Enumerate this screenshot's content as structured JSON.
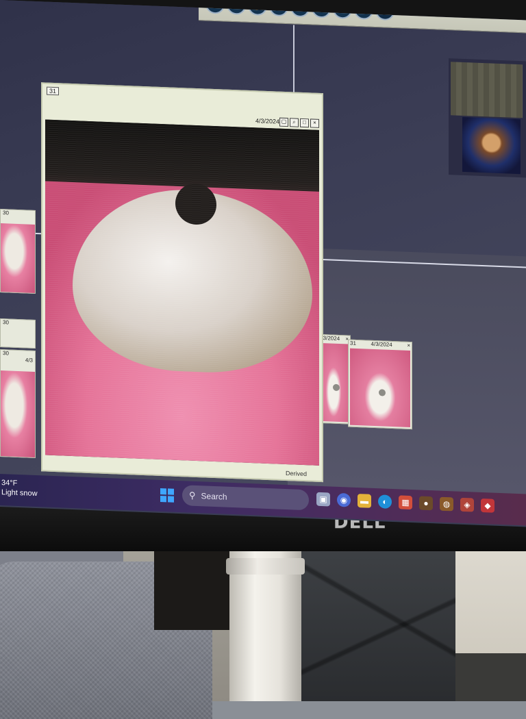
{
  "monitor": {
    "brand": "DELL"
  },
  "toolbar": {
    "close_label": "X"
  },
  "main_window": {
    "tooth_number": "31",
    "date": "4/3/2024",
    "footer": "Derived"
  },
  "left_thumbs": [
    {
      "label": "30"
    },
    {
      "label": "30"
    },
    {
      "label": "30"
    },
    {
      "label": "4/3"
    }
  ],
  "right_thumbs": [
    {
      "label": "",
      "date": "4/3/2024"
    },
    {
      "label": "31",
      "date": "4/3/2024"
    }
  ],
  "taskbar": {
    "weather_temp": "34°F",
    "weather_desc": "Light snow",
    "search_placeholder": "Search"
  },
  "colors": {
    "desktop": "#3a3d55",
    "window_chrome": "#e9ecd8",
    "taskbar_start": "#2b2552",
    "gum": "#e57398"
  }
}
